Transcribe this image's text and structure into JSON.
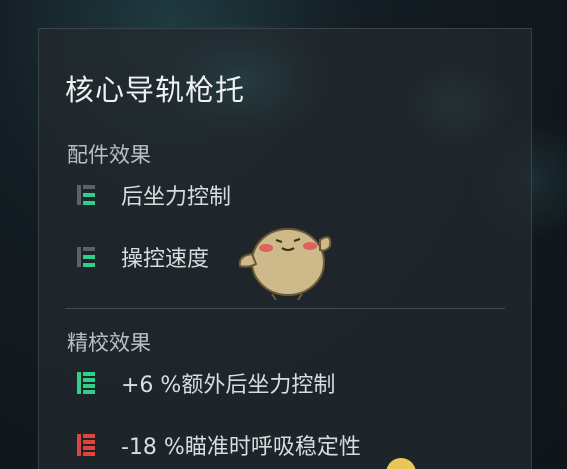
{
  "panel": {
    "title": "核心导轨枪托",
    "attachment_effects": {
      "label": "配件效果",
      "items": [
        {
          "label": "后坐力控制",
          "icon": "stat-bars-icon",
          "status": "neutral"
        },
        {
          "label": "操控速度",
          "icon": "stat-bars-icon",
          "status": "neutral"
        }
      ]
    },
    "calibration_effects": {
      "label": "精校效果",
      "items": [
        {
          "label": "+6 %额外后坐力控制",
          "icon": "stat-up-icon",
          "status": "positive"
        },
        {
          "label": "-18 %瞄准时呼吸稳定性",
          "icon": "stat-down-icon",
          "status": "negative"
        }
      ]
    }
  },
  "colors": {
    "positive": "#2fd08a",
    "negative": "#e0443f",
    "neutral_fill": "#2fd08a",
    "neutral_empty": "#5b6366"
  }
}
